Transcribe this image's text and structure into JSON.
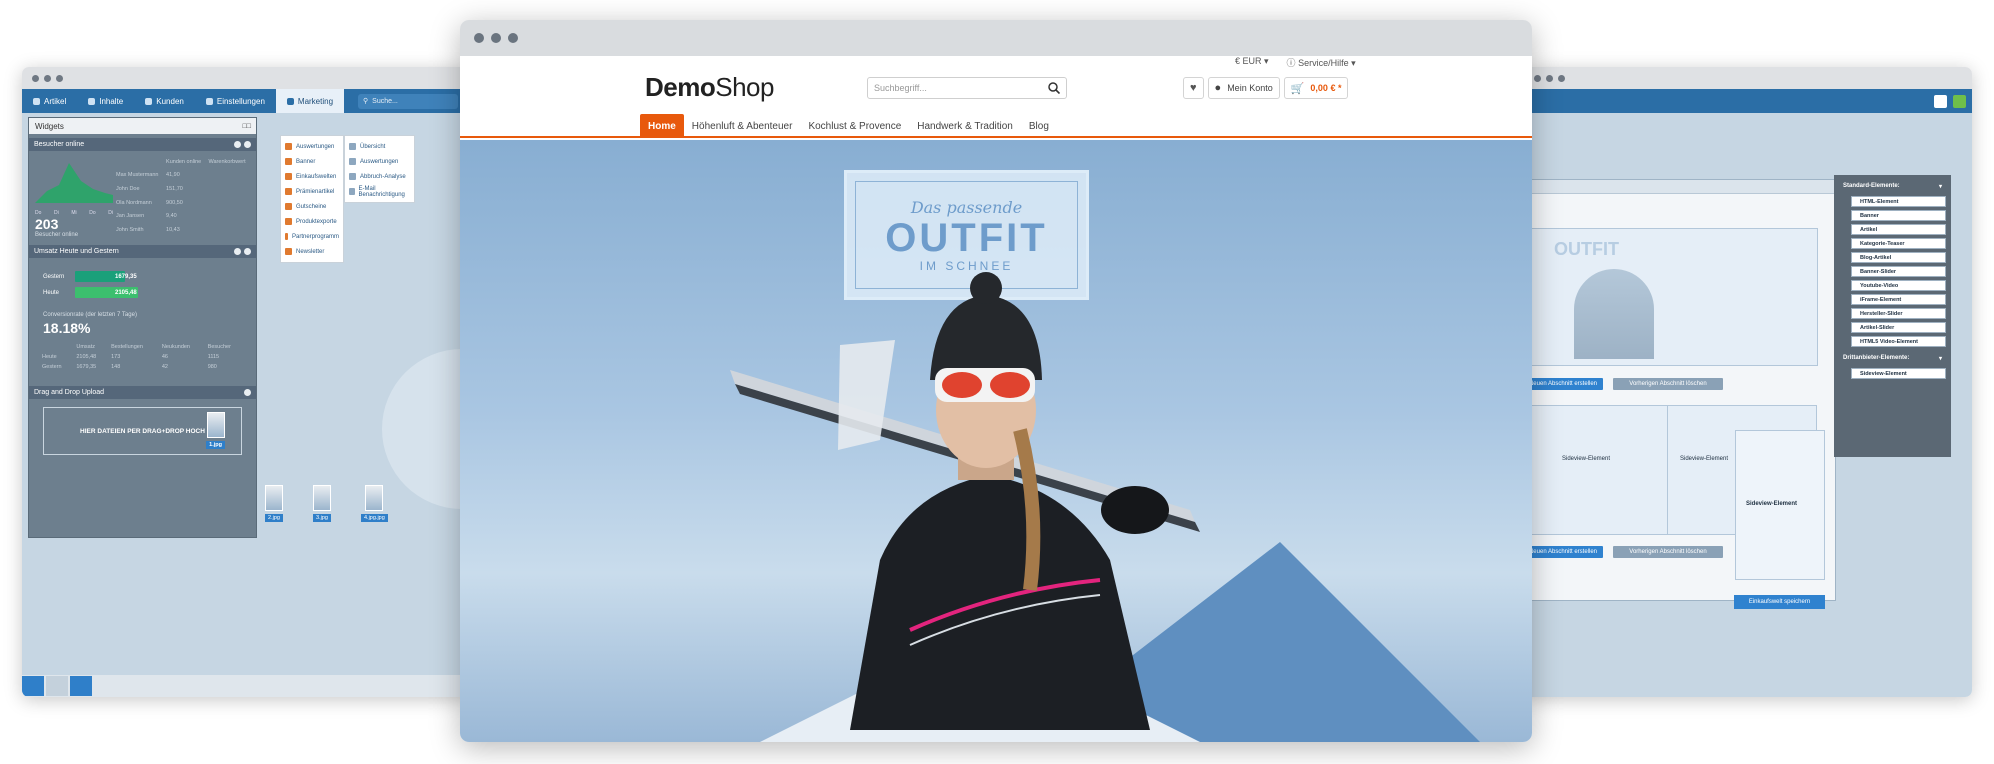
{
  "backend_left": {
    "menu": [
      "Artikel",
      "Inhalte",
      "Kunden",
      "Einstellungen",
      "Marketing"
    ],
    "search_placeholder": "Suche...",
    "widgets_title": "Widgets",
    "visitors_title": "Besucher online",
    "visitors_count": "203",
    "visitors_label": "Besucher online",
    "visitors_columns": [
      "Kunden online",
      "Warenkorbwert"
    ],
    "visitors_rows": [
      [
        "Max Mustermann",
        "41,90"
      ],
      [
        "John Doe",
        "151,70"
      ],
      [
        "Ola Nordmann",
        "900,50"
      ],
      [
        "Jan Jansen",
        "9,40"
      ],
      [
        "John Smith",
        "10,43"
      ]
    ],
    "weekdays": [
      "Do",
      "Di",
      "Mi",
      "Do",
      "Di"
    ],
    "sales_title": "Umsatz Heute und Gestern",
    "sales_rows": [
      {
        "label": "Gestern",
        "value": "1679,35",
        "color": "#1aa07a",
        "fraction": 0.72
      },
      {
        "label": "Heute",
        "value": "2105,48",
        "color": "#3cbf6e",
        "fraction": 0.9
      }
    ],
    "conversion_label": "Conversionrate (der letzten 7 Tage)",
    "conversion_value": "18.18%",
    "stats_header": [
      "Umsatz",
      "Bestellungen",
      "Neukunden",
      "Besucher"
    ],
    "stats_rows": [
      [
        "Heute",
        "2105,48",
        "173",
        "46",
        "1115"
      ],
      [
        "Gestern",
        "1679,35",
        "148",
        "42",
        "980"
      ]
    ],
    "upload_title": "Drag and Drop Upload",
    "upload_text": "HIER DATEIEN PER DRAG+DROP HOCH",
    "files": [
      "1.jpg",
      "2.jpg",
      "3.jpg",
      "4.jpg.jpg"
    ],
    "marketing_dropdown": [
      "Auswertungen",
      "Banner",
      "Einkaufswelten",
      "Prämienartikel",
      "Gutscheine",
      "Produktexporte",
      "Partnerprogramm",
      "Newsletter"
    ],
    "marketing_sub": [
      "Übersicht",
      "Auswertungen",
      "Abbruch-Analyse",
      "E-Mail Benachrichtigung"
    ]
  },
  "backend_right": {
    "btn_new_section": "Neuen Abschnitt erstellen",
    "btn_delete_section": "Vorherigen Abschnitt löschen",
    "element_label": "Sideview-Element",
    "save_label": "Einkaufswelt speichern",
    "panel_standard_title": "Standard-Elemente:",
    "panel_standard_items": [
      "HTML-Element",
      "Banner",
      "Artikel",
      "Kategorie-Teaser",
      "Blog-Artikel",
      "Banner-Slider",
      "Youtube-Video",
      "iFrame-Element",
      "Hersteller-Slider",
      "Artikel-Slider",
      "HTML5 Video-Element"
    ],
    "panel_third_title": "Drittanbieter-Elemente:",
    "panel_third_items": [
      "Sideview-Element"
    ],
    "banner_text": "OUTFIT"
  },
  "shop": {
    "logo_bold": "Demo",
    "logo_light": "Shop",
    "currency": "€ EUR",
    "service": "Service/Hilfe",
    "search_placeholder": "Suchbegriff...",
    "account": "Mein Konto",
    "cart": "0,00 € *",
    "nav": [
      "Home",
      "Höhenluft & Abenteuer",
      "Kochlust & Provence",
      "Handwerk & Tradition",
      "Blog"
    ],
    "banner_line1": "Das passende",
    "banner_line2": "OUTFIT",
    "banner_line3": "IM SCHNEE",
    "accent_color": "#e8590c"
  }
}
